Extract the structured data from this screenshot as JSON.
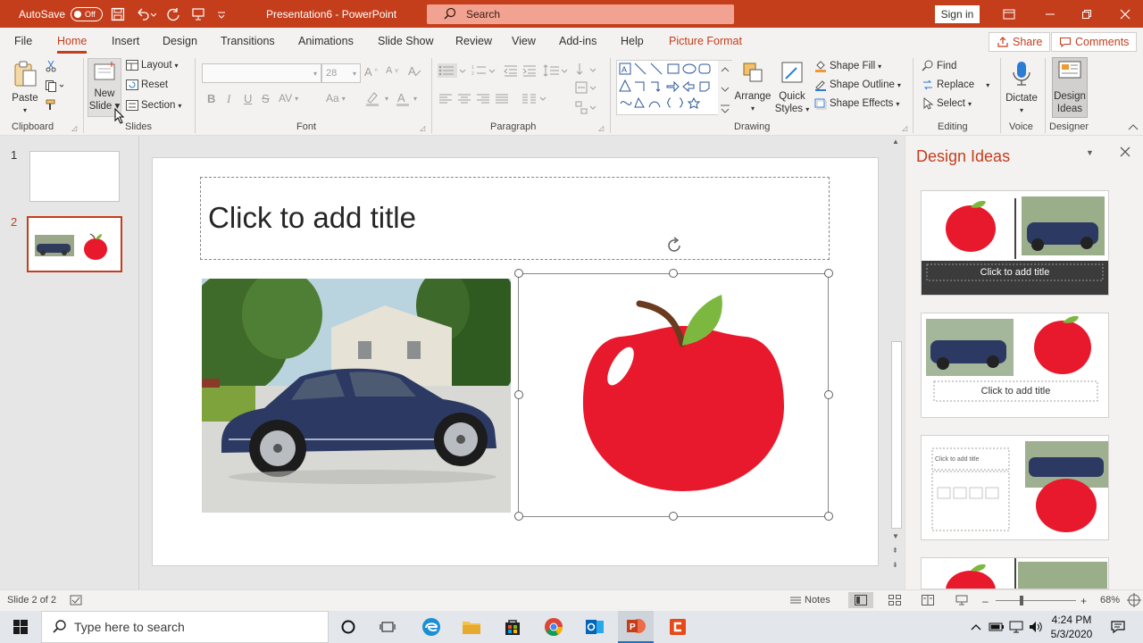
{
  "titlebar": {
    "autosave_label": "AutoSave",
    "autosave_state": "Off",
    "doc_title": "Presentation6 - PowerPoint",
    "search_placeholder": "Search",
    "signin_label": "Sign in"
  },
  "tabs": [
    "File",
    "Home",
    "Insert",
    "Design",
    "Transitions",
    "Animations",
    "Slide Show",
    "Review",
    "View",
    "Add-ins",
    "Help",
    "Picture Format"
  ],
  "active_tab": "Home",
  "share_label": "Share",
  "comments_label": "Comments",
  "ribbon": {
    "clipboard": {
      "paste": "Paste",
      "label": "Clipboard"
    },
    "slides": {
      "new_slide_1": "New",
      "new_slide_2": "Slide",
      "layout": "Layout",
      "reset": "Reset",
      "section": "Section",
      "label": "Slides"
    },
    "font": {
      "size_value": "28",
      "label": "Font",
      "bold": "B",
      "italic": "I",
      "underline": "U",
      "strike": "S"
    },
    "paragraph": {
      "label": "Paragraph"
    },
    "drawing": {
      "arrange": "Arrange",
      "quick_styles_1": "Quick",
      "quick_styles_2": "Styles",
      "shape_fill": "Shape Fill",
      "shape_outline": "Shape Outline",
      "shape_effects": "Shape Effects",
      "label": "Drawing"
    },
    "editing": {
      "find": "Find",
      "replace": "Replace",
      "select": "Select",
      "label": "Editing"
    },
    "voice": {
      "dictate": "Dictate",
      "label": "Voice"
    },
    "designer": {
      "design_ideas_1": "Design",
      "design_ideas_2": "Ideas",
      "label": "Designer"
    }
  },
  "thumbnails": [
    {
      "num": "1"
    },
    {
      "num": "2"
    }
  ],
  "slide": {
    "title_placeholder": "Click to add title"
  },
  "design_pane": {
    "title": "Design Ideas",
    "cards": [
      {
        "caption": "Click to add title"
      },
      {
        "caption": "Click to add title"
      },
      {
        "caption": "Click to add title"
      }
    ]
  },
  "statusbar": {
    "slide_info": "Slide 2 of 2",
    "notes_label": "Notes",
    "zoom": "68%"
  },
  "taskbar": {
    "search_placeholder": "Type here to search",
    "time": "4:24 PM",
    "date": "5/3/2020"
  },
  "colors": {
    "accent": "#c43e1c",
    "apple_red": "#e8192c",
    "leaf_green": "#7cb83f",
    "stem_brown": "#6b3b1f"
  }
}
